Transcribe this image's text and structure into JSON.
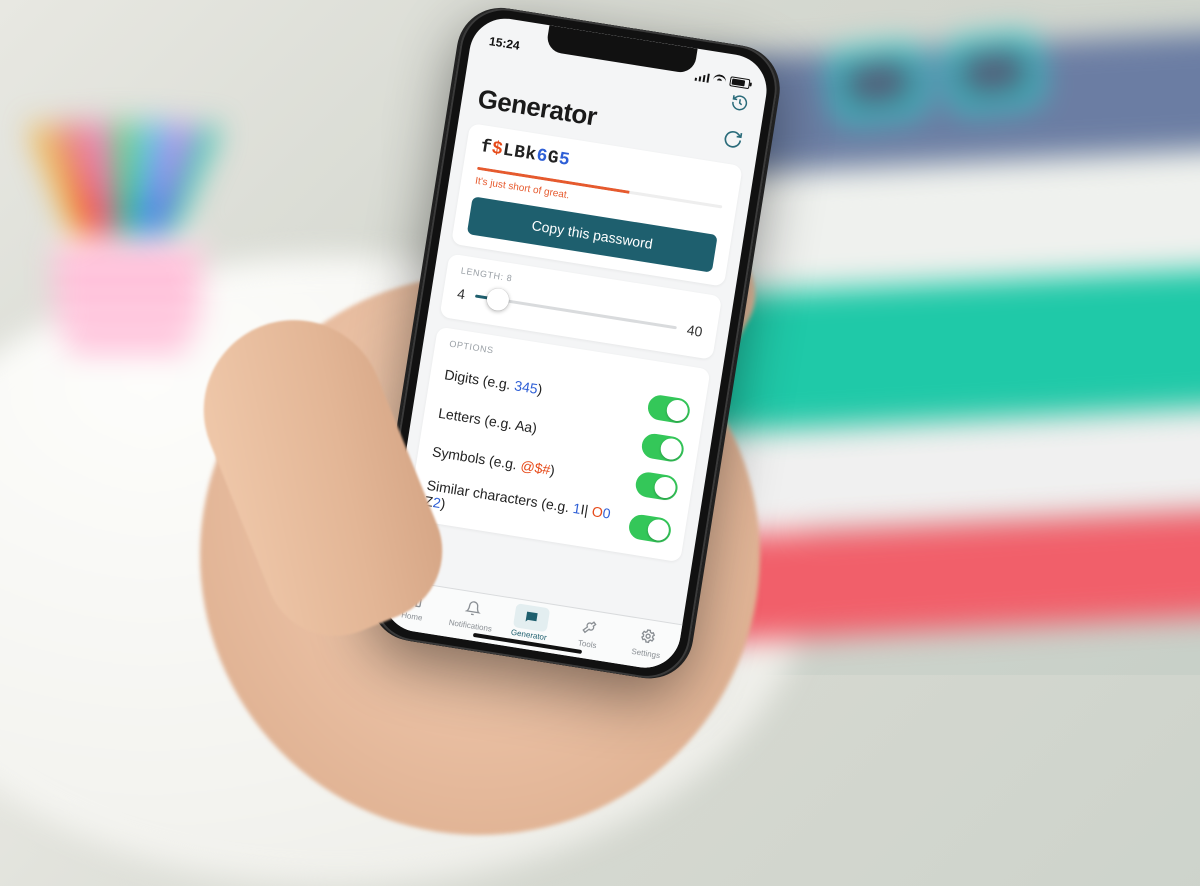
{
  "status": {
    "time": "15:24"
  },
  "header": {
    "title": "Generator"
  },
  "password": {
    "chars": [
      {
        "c": "f",
        "t": "letter"
      },
      {
        "c": "$",
        "t": "symbol"
      },
      {
        "c": "L",
        "t": "letter"
      },
      {
        "c": "B",
        "t": "letter"
      },
      {
        "c": "k",
        "t": "letter"
      },
      {
        "c": "6",
        "t": "digit"
      },
      {
        "c": "G",
        "t": "letter"
      },
      {
        "c": "5",
        "t": "digit"
      }
    ],
    "strength_pct": 62,
    "strength_text": "It's just short of great.",
    "copy_label": "Copy this password"
  },
  "length": {
    "label": "LENGTH: 8",
    "min": "4",
    "max": "40",
    "value": 8,
    "min_n": 4,
    "max_n": 40
  },
  "options": {
    "section_label": "OPTIONS",
    "rows": [
      {
        "label": "Digits (e.g. ",
        "example": "345",
        "example_class": "ex-digit",
        "suffix": ")",
        "on": true
      },
      {
        "label": "Letters (e.g. Aa)",
        "example": "",
        "example_class": "",
        "suffix": "",
        "on": true
      },
      {
        "label": "Symbols (e.g. ",
        "example": "@$#",
        "example_class": "ex-symbol",
        "suffix": ")",
        "on": true
      },
      {
        "label": "Similar characters (e.g. ",
        "example": "1",
        "example2": "I|",
        "example3": " O0 ",
        "example4": "Z2",
        "suffix": ")",
        "on": true
      }
    ]
  },
  "tabs": [
    {
      "label": "Home",
      "icon": "home"
    },
    {
      "label": "Notifications",
      "icon": "bell"
    },
    {
      "label": "Generator",
      "icon": "chat",
      "active": true
    },
    {
      "label": "Tools",
      "icon": "wrench"
    },
    {
      "label": "Settings",
      "icon": "gear"
    }
  ],
  "colors": {
    "accent": "#1e5f6e",
    "warn": "#e65a2e",
    "toggle_on": "#34c759"
  }
}
